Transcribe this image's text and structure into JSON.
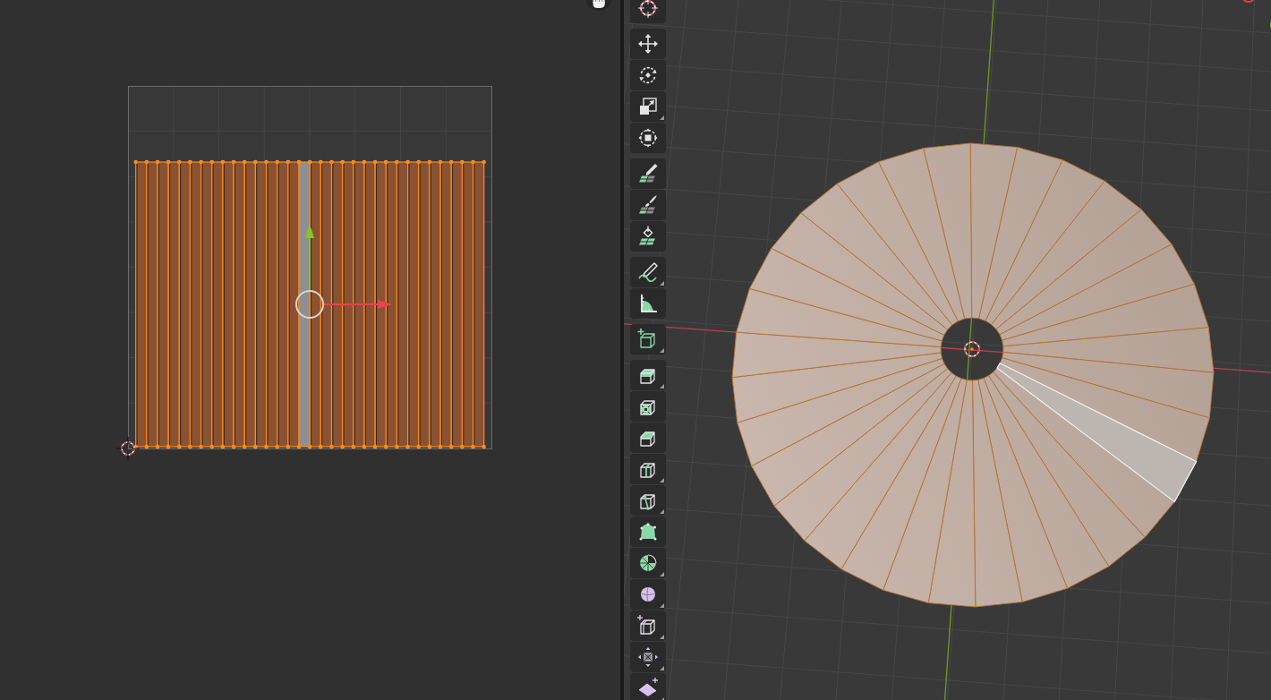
{
  "mesh": {
    "faces": [
      {
        "selected": true,
        "active": false
      },
      {
        "selected": true,
        "active": false
      },
      {
        "selected": true,
        "active": false
      },
      {
        "selected": true,
        "active": false
      },
      {
        "selected": true,
        "active": false
      },
      {
        "selected": true,
        "active": false
      },
      {
        "selected": true,
        "active": false
      },
      {
        "selected": true,
        "active": false
      },
      {
        "selected": true,
        "active": false
      },
      {
        "selected": true,
        "active": false
      },
      {
        "selected": true,
        "active": false
      },
      {
        "selected": true,
        "active": false
      },
      {
        "selected": true,
        "active": false
      },
      {
        "selected": true,
        "active": false
      },
      {
        "selected": true,
        "active": false
      },
      {
        "selected": true,
        "active": true
      },
      {
        "selected": true,
        "active": false
      },
      {
        "selected": true,
        "active": false
      },
      {
        "selected": true,
        "active": false
      },
      {
        "selected": true,
        "active": false
      },
      {
        "selected": true,
        "active": false
      },
      {
        "selected": true,
        "active": false
      },
      {
        "selected": true,
        "active": false
      },
      {
        "selected": true,
        "active": false
      },
      {
        "selected": true,
        "active": false
      },
      {
        "selected": true,
        "active": false
      },
      {
        "selected": true,
        "active": false
      },
      {
        "selected": true,
        "active": false
      },
      {
        "selected": true,
        "active": false
      },
      {
        "selected": true,
        "active": false
      },
      {
        "selected": true,
        "active": false
      },
      {
        "selected": true,
        "active": false
      }
    ]
  },
  "toolbar": {
    "groups": [
      {
        "tools": [
          {
            "kind": "cursor",
            "selected": false,
            "has_variants": false
          }
        ]
      },
      {
        "tools": [
          {
            "kind": "move",
            "selected": false,
            "has_variants": false
          },
          {
            "kind": "rotate",
            "selected": false,
            "has_variants": false
          },
          {
            "kind": "scale",
            "selected": false,
            "has_variants": true
          },
          {
            "kind": "transform",
            "selected": false,
            "has_variants": false
          }
        ]
      },
      {
        "tools": [
          {
            "kind": "pencil",
            "selected": false,
            "has_variants": false
          },
          {
            "kind": "brush",
            "selected": false,
            "has_variants": false
          },
          {
            "kind": "fill",
            "selected": false,
            "has_variants": false
          }
        ]
      },
      {
        "tools": [
          {
            "kind": "annotate",
            "selected": false,
            "has_variants": true
          },
          {
            "kind": "measure",
            "selected": false,
            "has_variants": false
          }
        ]
      },
      {
        "tools": [
          {
            "kind": "cube",
            "selected": false,
            "has_variants": true
          }
        ]
      },
      {
        "tools": [
          {
            "kind": "extrude",
            "selected": false,
            "has_variants": true
          },
          {
            "kind": "inset",
            "selected": false,
            "has_variants": false
          },
          {
            "kind": "bevel",
            "selected": false,
            "has_variants": false
          },
          {
            "kind": "loopcut",
            "selected": false,
            "has_variants": true
          },
          {
            "kind": "knife",
            "selected": false,
            "has_variants": true
          },
          {
            "kind": "polybuild",
            "selected": false,
            "has_variants": false
          },
          {
            "kind": "spin",
            "selected": false,
            "has_variants": true
          },
          {
            "kind": "smooth",
            "selected": false,
            "has_variants": true
          },
          {
            "kind": "shrink",
            "selected": false,
            "has_variants": true
          },
          {
            "kind": "push",
            "selected": false,
            "has_variants": true
          },
          {
            "kind": "shear",
            "selected": false,
            "has_variants": true
          }
        ]
      }
    ]
  }
}
